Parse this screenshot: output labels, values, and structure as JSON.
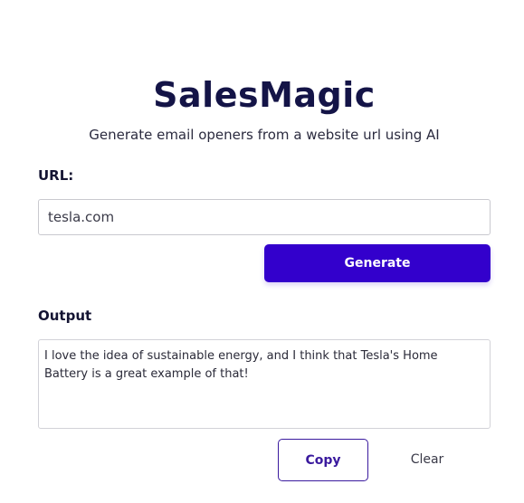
{
  "header": {
    "title": "SalesMagic",
    "subtitle": "Generate email openers from a website url using AI"
  },
  "url_field": {
    "label": "URL:",
    "value": "tesla.com",
    "placeholder": ""
  },
  "actions": {
    "generate_label": "Generate",
    "copy_label": "Copy",
    "clear_label": "Clear"
  },
  "output": {
    "label": "Output",
    "text": "I love the idea of sustainable energy, and I think that Tesla's Home Battery is a great example of that!"
  },
  "colors": {
    "accent": "#3300cc",
    "title": "#141447",
    "outline_button": "#3a1a9e"
  }
}
